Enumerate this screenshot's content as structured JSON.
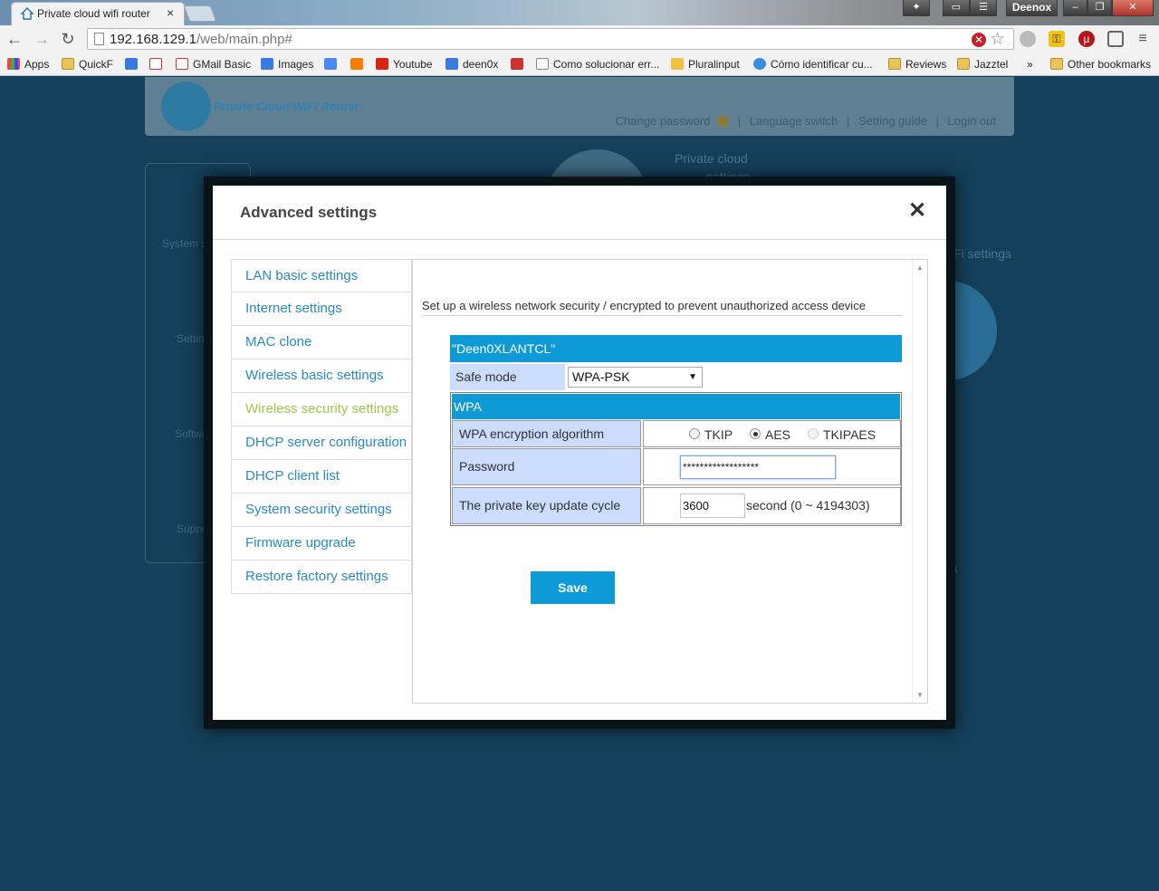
{
  "browser": {
    "tab_title": "Private cloud wifi router",
    "profile_name": "Deenox",
    "url_host": "192.168.129.1",
    "url_path": "/web/main.php#",
    "bookmarks": [
      "Apps",
      "QuickF",
      "GMail Basic",
      "Images",
      "Youtube",
      "deen0x",
      "Como solucionar err...",
      "Pluralinput",
      "Cómo identificar cu...",
      "Reviews",
      "Jazztel",
      "»",
      "Other bookmarks"
    ]
  },
  "router": {
    "brand": "Private Cloud WiFi Router",
    "header_links": [
      "Change password",
      "Language switch",
      "Setting guide",
      "Login out"
    ],
    "bg_private_cloud": "Private cloud",
    "bg_settings": "settings",
    "bg_wifi": "iFi settings",
    "side_labels": [
      "System st",
      "Settin",
      "Softwa",
      "Suppo"
    ],
    "bg_bot": "ot"
  },
  "modal": {
    "title": "Advanced settings",
    "menu": [
      {
        "label": "LAN basic settings",
        "active": false
      },
      {
        "label": "Internet settings",
        "active": false
      },
      {
        "label": "MAC clone",
        "active": false
      },
      {
        "label": "Wireless basic settings",
        "active": false
      },
      {
        "label": "Wireless security settings",
        "active": true
      },
      {
        "label": "DHCP server configuration",
        "active": false
      },
      {
        "label": "DHCP client list",
        "active": false
      },
      {
        "label": "System security settings",
        "active": false
      },
      {
        "label": "Firmware upgrade",
        "active": false
      },
      {
        "label": "Restore factory settings",
        "active": false
      }
    ],
    "intro": "Set up a wireless network security / encrypted to prevent unauthorized access device",
    "ssid": "\"Deen0XLANTCL\"",
    "safe_mode_label": "Safe mode",
    "safe_mode_value": "WPA-PSK",
    "wpa_header": "WPA",
    "algorithm_label": "WPA encryption algorithm",
    "algorithm_options": [
      {
        "label": "TKIP",
        "checked": false,
        "disabled": false
      },
      {
        "label": "AES",
        "checked": true,
        "disabled": false
      },
      {
        "label": "TKIPAES",
        "checked": false,
        "disabled": true
      }
    ],
    "password_label": "Password",
    "password_value": "******************",
    "cycle_label": "The private key update cycle",
    "cycle_value": "3600",
    "cycle_unit": "second (0 ~ 4194303)",
    "save_label": "Save"
  },
  "colors": {
    "accent_blue": "#0d9ad7",
    "active_menu_green": "#9bc84b",
    "label_cell_blue": "#cbdcfc",
    "link_blue": "#2a8ac4"
  }
}
